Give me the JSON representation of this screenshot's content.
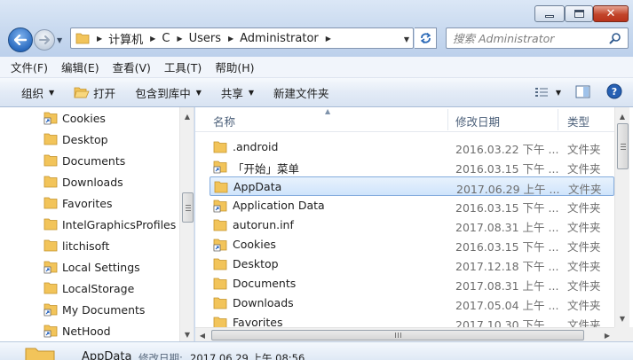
{
  "window": {
    "address": {
      "segments": [
        "计算机",
        "C",
        "Users",
        "Administrator"
      ]
    },
    "search": {
      "placeholder": "搜索 Administrator"
    }
  },
  "menu": [
    "文件(F)",
    "编辑(E)",
    "查看(V)",
    "工具(T)",
    "帮助(H)"
  ],
  "commands": {
    "organize": "组织",
    "open": "打开",
    "include_library": "包含到库中",
    "share": "共享",
    "new_folder": "新建文件夹"
  },
  "nav_items": [
    {
      "label": "Cookies",
      "icon": "shortcut-folder-icon"
    },
    {
      "label": "Desktop",
      "icon": "folder-icon"
    },
    {
      "label": "Documents",
      "icon": "folder-icon"
    },
    {
      "label": "Downloads",
      "icon": "folder-icon"
    },
    {
      "label": "Favorites",
      "icon": "folder-icon"
    },
    {
      "label": "IntelGraphicsProfiles",
      "icon": "folder-icon"
    },
    {
      "label": "litchisoft",
      "icon": "folder-icon"
    },
    {
      "label": "Local Settings",
      "icon": "shortcut-folder-icon"
    },
    {
      "label": "LocalStorage",
      "icon": "folder-icon"
    },
    {
      "label": "My Documents",
      "icon": "shortcut-folder-icon"
    },
    {
      "label": "NetHood",
      "icon": "shortcut-folder-icon"
    }
  ],
  "columns": {
    "name": "名称",
    "date": "修改日期",
    "type": "类型"
  },
  "files": [
    {
      "name": ".android",
      "date": "2016.03.22 下午 ...",
      "type": "文件夹",
      "icon": "folder-icon"
    },
    {
      "name": "「开始」菜单",
      "date": "2016.03.15 下午 ...",
      "type": "文件夹",
      "icon": "shortcut-folder-icon"
    },
    {
      "name": "AppData",
      "date": "2017.06.29 上午 ...",
      "type": "文件夹",
      "icon": "folder-icon"
    },
    {
      "name": "Application Data",
      "date": "2016.03.15 下午 ...",
      "type": "文件夹",
      "icon": "shortcut-folder-icon"
    },
    {
      "name": "autorun.inf",
      "date": "2017.08.31 上午 ...",
      "type": "文件夹",
      "icon": "folder-icon"
    },
    {
      "name": "Cookies",
      "date": "2016.03.15 下午 ...",
      "type": "文件夹",
      "icon": "shortcut-folder-icon"
    },
    {
      "name": "Desktop",
      "date": "2017.12.18 下午 ...",
      "type": "文件夹",
      "icon": "folder-icon"
    },
    {
      "name": "Documents",
      "date": "2017.08.31 上午 ...",
      "type": "文件夹",
      "icon": "folder-icon"
    },
    {
      "name": "Downloads",
      "date": "2017.05.04 上午 ...",
      "type": "文件夹",
      "icon": "folder-icon"
    },
    {
      "name": "Favorites",
      "date": "2017.10.30 下午 ...",
      "type": "文件夹",
      "icon": "folder-icon"
    }
  ],
  "selected_file": "AppData",
  "details": {
    "name": "AppData",
    "modified_label": "修改日期:",
    "modified_value": "2017.06.29 上午 08:56"
  },
  "colors": {
    "chrome": "#c8d9ef",
    "selection": "#cfe4fb",
    "selection_border": "#84acdd",
    "folder": "#f2c45a"
  }
}
